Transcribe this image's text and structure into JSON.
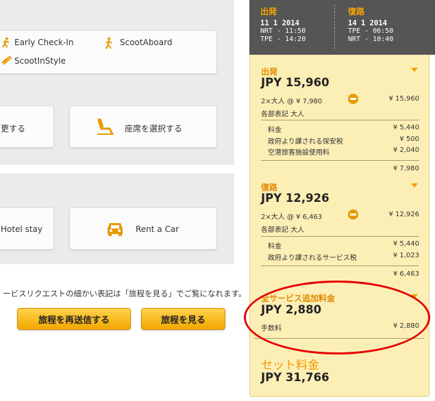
{
  "services": {
    "early_checkin": "Early Check-In",
    "scoot_aboard": "ScootAboard",
    "scoot_in_style": "ScootInStyle",
    "change_label": "更する",
    "select_seat": "座席を選択する",
    "hotel_stay": "Hotel stay",
    "rent_a_car": "Rent a Car"
  },
  "note": "ービスリクエストの細かい表記は「旅程を見る」でご覧になれます。",
  "buttons": {
    "resend": "旅程を再送信する",
    "view": "旅程を見る"
  },
  "header": {
    "outbound": {
      "label": "出発",
      "date": "11 1 2014",
      "dep": "NRT - 11:50",
      "arr": "TPE - 14:20"
    },
    "inbound": {
      "label": "復路",
      "date": "14 1 2014",
      "dep": "TPE - 06:50",
      "arr": "NRT - 10:40"
    }
  },
  "outbound": {
    "label": "出発",
    "total": "JPY 15,960",
    "pax": "2×大人 @  ¥ 7,980",
    "pax_total": "¥ 15,960",
    "per_label": "各部表記 大人",
    "lines": [
      {
        "label": "料金",
        "value": "¥ 5,440"
      },
      {
        "label": "政府より課される保安税",
        "value": "¥ 500"
      },
      {
        "label": "空港旅客施設使用料",
        "value": "¥ 2,040"
      }
    ],
    "subtotal": "¥ 7,980"
  },
  "inbound": {
    "label": "復路",
    "total": "JPY 12,926",
    "pax": "2×大人 @  ¥ 6,463",
    "pax_total": "¥ 12,926",
    "per_label": "各部表記 大人",
    "lines": [
      {
        "label": "料金",
        "value": "¥ 5,440"
      },
      {
        "label": "政府より課されるサービス税",
        "value": "¥ 1,023"
      }
    ],
    "subtotal": "¥ 6,463"
  },
  "extras": {
    "label": "全サービス追加料金",
    "total": "JPY 2,880",
    "fee_label": "手数料",
    "fee_value": "¥ 2,880"
  },
  "grand": {
    "label": "セット料金",
    "total": "JPY 31,766"
  },
  "colors": {
    "accent": "#f7a600",
    "highlight": "#e60000",
    "summary_bg": "#fcefb6"
  }
}
